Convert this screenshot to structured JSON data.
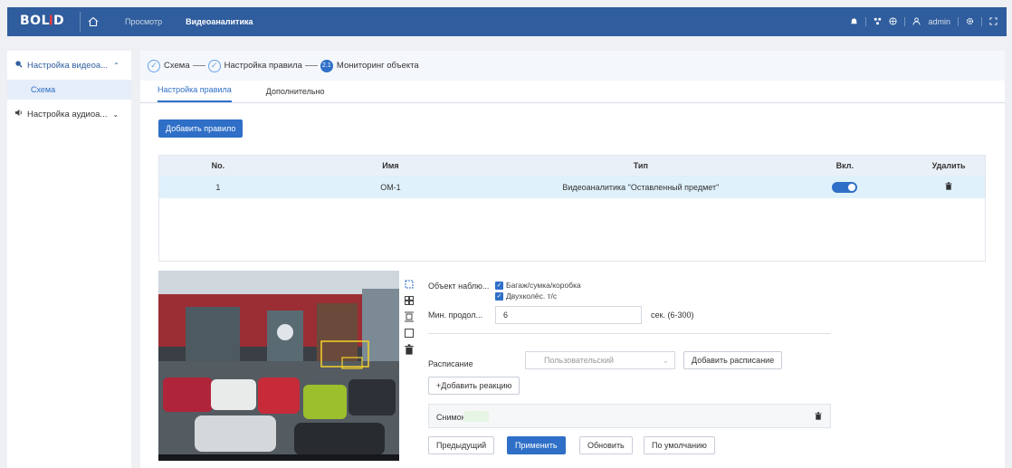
{
  "topbar": {
    "logo": "BOLID",
    "nav": [
      "Просмотр",
      "Видеоаналитика"
    ],
    "user": "admin"
  },
  "sidebar": {
    "items": [
      {
        "label": "Настройка видеоа...",
        "expanded": true
      },
      {
        "label": "Схема"
      },
      {
        "label": "Настройка аудиоа...",
        "expanded": false
      }
    ]
  },
  "steps": [
    {
      "label": "Схема",
      "state": "done"
    },
    {
      "label": "Настройка правила",
      "state": "done"
    },
    {
      "label": "Мониторинг объекта",
      "state": "current",
      "number": "2.1"
    }
  ],
  "tabs": [
    "Настройка правила",
    "Дополнительно"
  ],
  "add_rule_button": "Добавить правило",
  "table": {
    "headers": [
      "No.",
      "Имя",
      "Тип",
      "Вкл.",
      "Удалить"
    ],
    "rows": [
      {
        "no": "1",
        "name": "OM-1",
        "type": "Видеоаналитика \"Оставленный предмет\"",
        "enabled": true
      }
    ]
  },
  "settings": {
    "object_label": "Объект наблю...",
    "objects": [
      "Багаж/сумка/коробка",
      "Двухколёс. т/с"
    ],
    "min_duration_label": "Мин. продол...",
    "min_duration_value": "6",
    "min_duration_unit": "сек. (6-300)",
    "schedule_label": "Расписание",
    "schedule_value": "Пользовательский",
    "add_schedule_button": "Добавить расписание",
    "add_reaction_button": "+Добавить реакцию",
    "snapshot_label": "Снимок"
  },
  "footer_buttons": {
    "prev": "Предыдущий",
    "apply": "Применить",
    "refresh": "Обновить",
    "default": "По умолчанию"
  },
  "colors": {
    "accent": "#2f6fc7",
    "topbar": "#2f5d9d"
  }
}
